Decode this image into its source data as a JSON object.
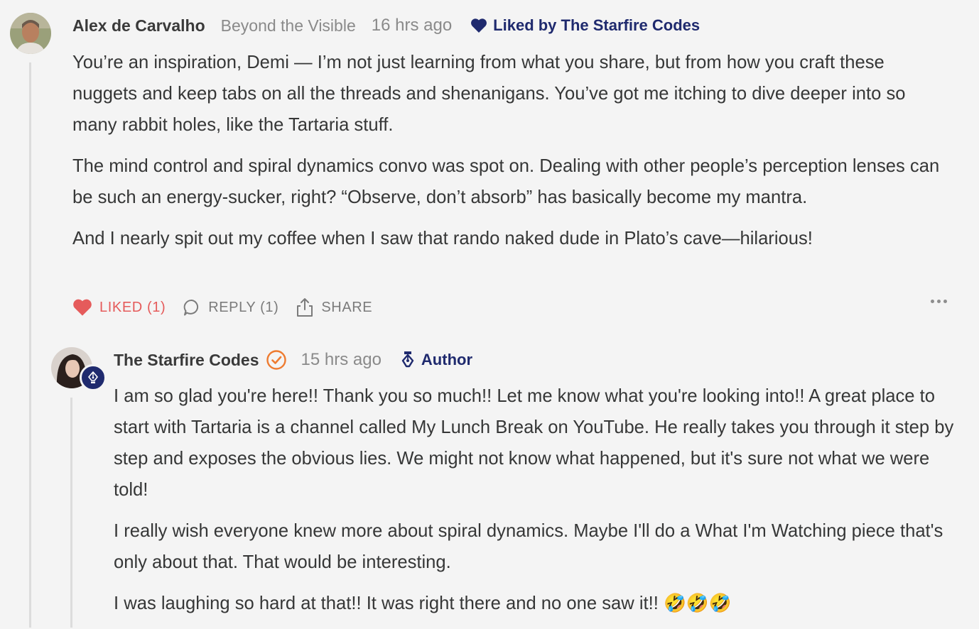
{
  "comment": {
    "author": "Alex de Carvalho",
    "publication": "Beyond the Visible",
    "time": "16 hrs ago",
    "liked_by": "Liked by The Starfire Codes",
    "paragraphs": [
      "You’re an inspiration, Demi — I’m not just learning from what you share, but from how you craft these nuggets and keep tabs on all the threads and shenanigans. You’ve got me itching to dive deeper into so many rabbit holes, like the Tartaria stuff.",
      "The mind control and spiral dynamics convo was spot on. Dealing with other people’s perception lenses can be such an energy-sucker, right? “Observe, don’t absorb” has basically become my mantra.",
      "And I nearly spit out my coffee when I saw that rando naked dude in Plato’s cave—hilarious!"
    ],
    "actions": {
      "liked": "LIKED (1)",
      "reply": "REPLY (1)",
      "share": "SHARE"
    }
  },
  "reply": {
    "author": "The Starfire Codes",
    "time": "15 hrs ago",
    "badge": "Author",
    "paragraphs": [
      "I am so glad you're here!! Thank you so much!! Let me know what you're looking into!! A great place to start with Tartaria is a channel called My Lunch Break on YouTube. He really takes you through it step by step and exposes the obvious lies. We might not know what happened, but it's sure not what we were told!",
      "I really wish everyone knew more about spiral dynamics. Maybe I'll do a What I'm Watching piece that's only about that. That would be interesting.",
      "I was laughing so hard at that!! It was right there and no one saw it!! 🤣🤣🤣"
    ]
  },
  "colors": {
    "background": "#f4f4f4",
    "text": "#363737",
    "muted": "#8a8a8a",
    "navy": "#1f2a6e",
    "liked_red": "#e55b5b",
    "verified_orange": "#ee7b30"
  }
}
